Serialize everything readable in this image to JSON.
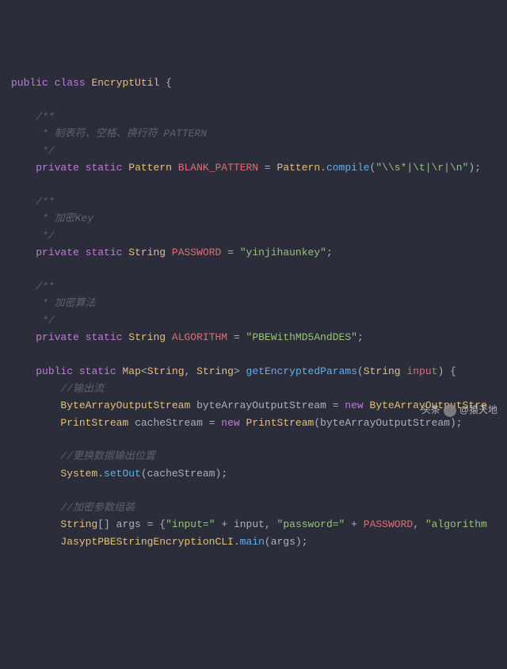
{
  "kw": {
    "public": "public",
    "class": "class",
    "private": "private",
    "static": "static",
    "new": "new"
  },
  "code": {
    "classname": "EncryptUtil",
    "lbrace": "{",
    "rbrace": "}",
    "doc_open": "/**",
    "doc_star": " *",
    "doc_close": " */",
    "comment1": " * 制表符、空格、换行符 PATTERN",
    "type_pattern": "Pattern",
    "const_blank": "BLANK_PATTERN",
    "eq": " = ",
    "pattern_call_a": "Pattern",
    "compile": "compile",
    "str_blank": "\"\\\\s*|\\t|\\r|\\n\"",
    "semi": ";",
    "comment2": " * 加密Key",
    "type_string": "String",
    "const_pw": "PASSWORD",
    "str_pw": "\"yinjihaunkey\"",
    "comment3": " * 加密算法",
    "const_alg": "ALGORITHM",
    "str_alg": "\"PBEWithMD5AndDES\"",
    "map": "Map",
    "lt": "<",
    "gt": ">",
    "comma": ", ",
    "method_get": "getEncryptedParams",
    "lparen": "(",
    "rparen": ")",
    "param_input": "input",
    "c_out": "//输出流",
    "baos_t": "ByteArrayOutputStream",
    "baos_v": "byteArrayOutputStream",
    "baos_new": "ByteArrayOutputStre",
    "ps_t": "PrintStream",
    "ps_v": "cacheStream",
    "ps_ctor": "PrintStream",
    "c_swap": "//更换数据输出位置",
    "system": "System",
    "setout": "setOut",
    "c_args": "//加密参数组装",
    "str_arr": "String",
    "brackets": "[]",
    "args_v": "args",
    "arr_open": "{",
    "arr_close": "}",
    "str_input_eq": "\"input=\"",
    "plus": " + ",
    "input_v": "input",
    "str_pw_eq": "\"password=\"",
    "pw_ref": "PASSWORD",
    "tail": "\"algorithm",
    "cli_class": "JasyptPBEStringEncryptionCLI",
    "main": "main",
    "args_ref": "args"
  },
  "watermark": {
    "prefix": "头条",
    "handle": "@猿天地"
  }
}
